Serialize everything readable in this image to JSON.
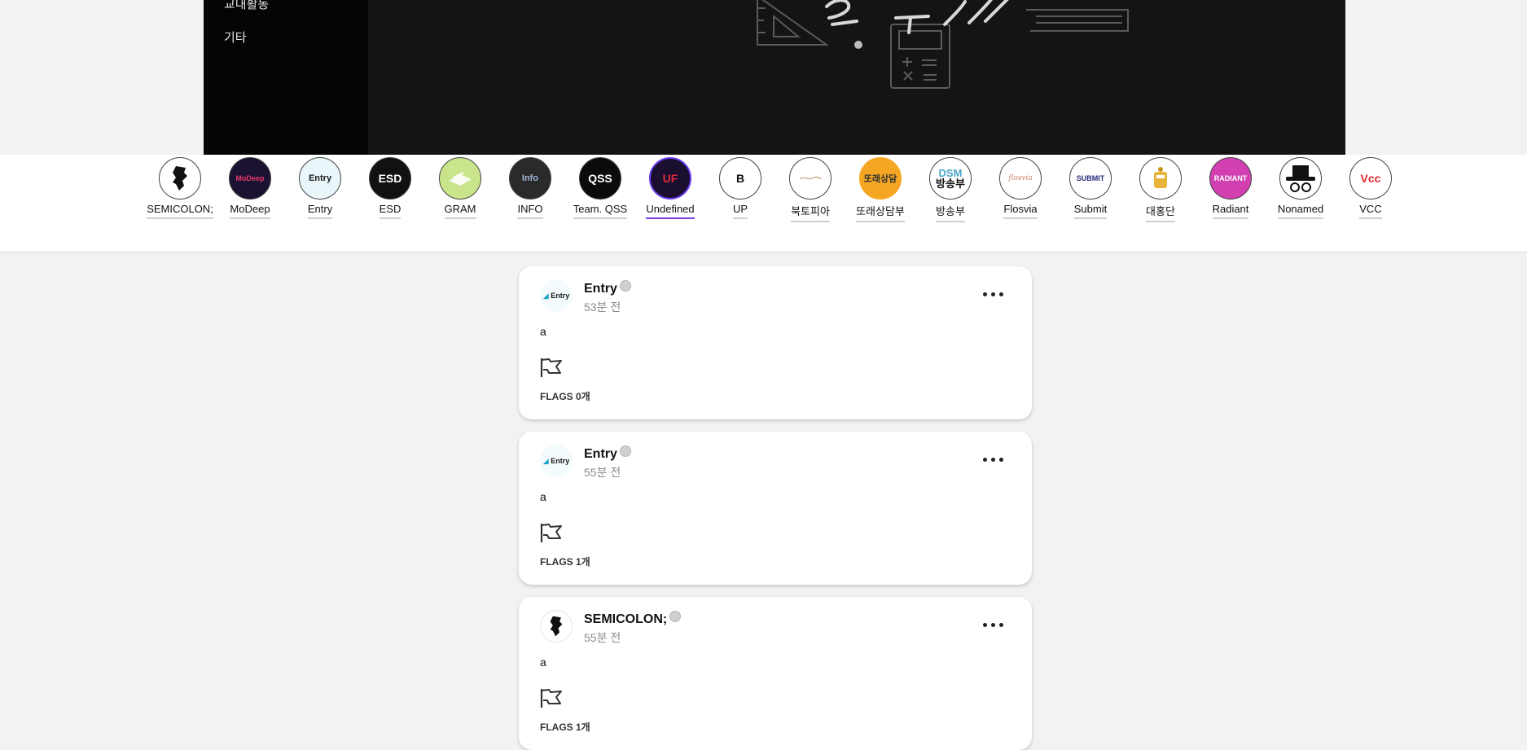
{
  "banner": {
    "menu_cut": "교내활동",
    "menu_etc": "기타"
  },
  "clubs": [
    {
      "name": "SEMICOLON;",
      "logo_bg": "#ffffff",
      "logo_fg": "#111111",
      "logo_text": "",
      "icon": "korea-map-icon"
    },
    {
      "name": "MoDeep",
      "logo_bg": "#1a1230",
      "logo_fg": "#e83a6a",
      "logo_text": "MoDeep",
      "icon": "modeep-logo"
    },
    {
      "name": "Entry",
      "logo_bg": "#e9f7fb",
      "logo_fg": "#1a1a1a",
      "logo_text": "Entry",
      "icon": "entry-logo"
    },
    {
      "name": "ESD",
      "logo_bg": "#111111",
      "logo_fg": "#ffffff",
      "logo_text": "ESD",
      "icon": "esd-logo"
    },
    {
      "name": "GRAM",
      "logo_bg": "#c9e48a",
      "logo_fg": "#ffffff",
      "logo_text": "",
      "icon": "gram-logo"
    },
    {
      "name": "INFO",
      "logo_bg": "#2a2a2a",
      "logo_fg": "#9fb7d8",
      "logo_text": "Info",
      "icon": "info-logo"
    },
    {
      "name": "Team. QSS",
      "logo_bg": "#0b0b0b",
      "logo_fg": "#ffffff",
      "logo_text": "QSS",
      "icon": "qss-logo"
    },
    {
      "name": "Undefined",
      "logo_bg": "#1a0f2e",
      "logo_fg": "#e02a3a",
      "logo_text": "UF",
      "icon": "undefined-logo"
    },
    {
      "name": "UP",
      "logo_bg": "#ffffff",
      "logo_fg": "#111111",
      "logo_text": "B",
      "icon": "up-logo"
    },
    {
      "name": "북토피아",
      "logo_bg": "#ffffff",
      "logo_fg": "#b8a27a",
      "logo_text": "",
      "icon": "booktopia-logo"
    },
    {
      "name": "또래상담부",
      "logo_bg": "#f5a623",
      "logo_fg": "#333333",
      "logo_text": "또래상담",
      "icon": "peer-counsel-logo"
    },
    {
      "name": "방송부",
      "logo_bg": "#ffffff",
      "logo_fg": "#111111",
      "logo_text": "방송부",
      "logo_top": "DSM",
      "icon": "broadcast-logo"
    },
    {
      "name": "Flosvia",
      "logo_bg": "#ffffff",
      "logo_fg": "#c9826e",
      "logo_text": "flosvia",
      "icon": "flosvia-logo"
    },
    {
      "name": "Submit",
      "logo_bg": "#ffffff",
      "logo_fg": "#2a2a7a",
      "logo_text": "SUBMIT",
      "icon": "submit-logo"
    },
    {
      "name": "대홍단",
      "logo_bg": "#ffffff",
      "logo_fg": "#c8961e",
      "logo_text": "",
      "icon": "daehongdan-logo"
    },
    {
      "name": "Radiant",
      "logo_bg": "#d13fb1",
      "logo_fg": "#ffffff",
      "logo_text": "RADIANT",
      "icon": "radiant-logo"
    },
    {
      "name": "Nonamed",
      "logo_bg": "#ffffff",
      "logo_fg": "#111111",
      "logo_text": "",
      "icon": "hat-logo"
    },
    {
      "name": "VCC",
      "logo_bg": "#ffffff",
      "logo_fg": "#e0262a",
      "logo_text": "Vcc",
      "icon": "vcc-logo"
    }
  ],
  "active_club": "Undefined",
  "posts": [
    {
      "author": "Entry",
      "time": "53분 전",
      "body": "a",
      "flags": "FLAGS 0개",
      "avatar": "entry-avatar"
    },
    {
      "author": "Entry",
      "time": "55분 전",
      "body": "a",
      "flags": "FLAGS 1개",
      "avatar": "entry-avatar"
    },
    {
      "author": "SEMICOLON;",
      "time": "55분 전",
      "body": "a",
      "flags": "FLAGS 1개",
      "avatar": "semicolon-avatar"
    }
  ],
  "colors": {
    "page_bg": "#f2f2f2",
    "banner_bg": "#141414",
    "active_underline": "#7b3fe4",
    "time_text": "#8b8b8b"
  }
}
